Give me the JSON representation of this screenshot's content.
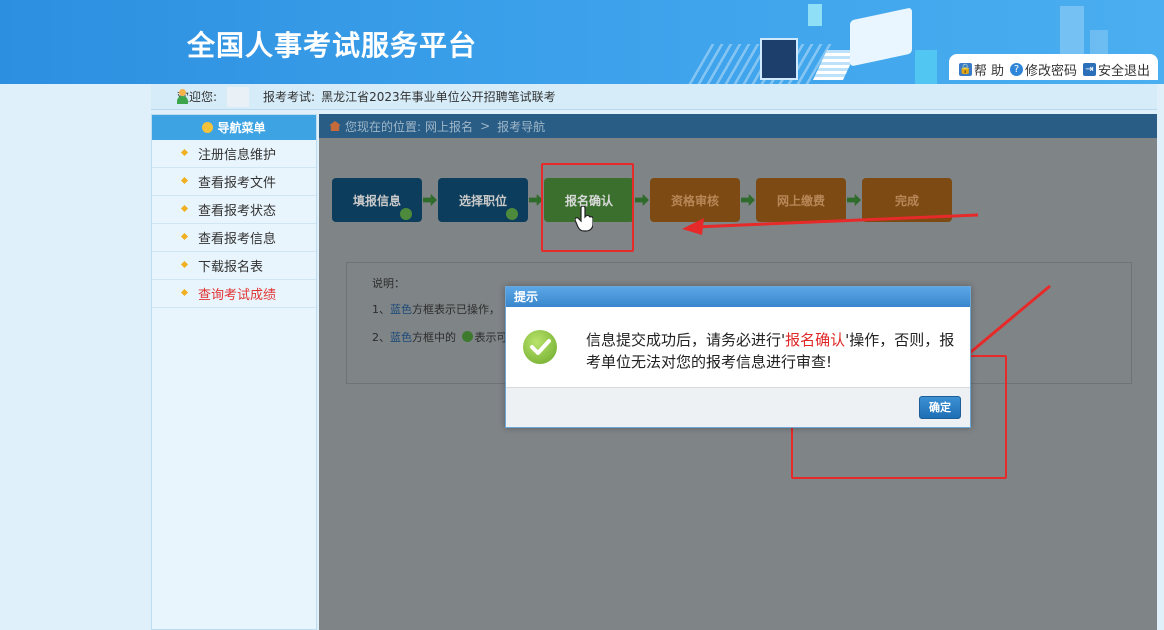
{
  "header": {
    "title": "全国人事考试服务平台",
    "links": [
      {
        "label": "帮 助",
        "icon": "lock-icon"
      },
      {
        "label": "修改密码",
        "icon": "question-icon"
      },
      {
        "label": "安全退出",
        "icon": "exit-icon"
      }
    ]
  },
  "infobar": {
    "welcome": "欢迎您:",
    "exam_label": "报考考试:",
    "exam_name": "黑龙江省2023年事业单位公开招聘笔试联考"
  },
  "sidebar": {
    "title": "导航菜单",
    "items": [
      {
        "label": "注册信息维护"
      },
      {
        "label": "查看报考文件"
      },
      {
        "label": "查看报考状态"
      },
      {
        "label": "查看报考信息"
      },
      {
        "label": "下载报名表"
      },
      {
        "label": "查询考试成绩"
      }
    ]
  },
  "breadcrumb": {
    "prefix": "您现在的位置:",
    "items": [
      "网上报名",
      "报考导航"
    ],
    "sep": ">"
  },
  "steps": [
    {
      "label": "填报信息",
      "state": "done"
    },
    {
      "label": "选择职位",
      "state": "done"
    },
    {
      "label": "报名确认",
      "state": "active"
    },
    {
      "label": "资格审核",
      "state": "todo"
    },
    {
      "label": "网上缴费",
      "state": "todo"
    },
    {
      "label": "完成",
      "state": "todo"
    }
  ],
  "explain": {
    "title": "说明：",
    "line1_prefix": "1、",
    "line1_blue": "蓝色",
    "line1_rest": "方框表示已操作，",
    "line2_prefix": "2、",
    "line2_blue": "蓝色",
    "line2_rest": "方框中的",
    "line2_tail": "表示可"
  },
  "dialog": {
    "title": "提示",
    "msg_part1": "信息提交成功后，请务必进行'",
    "msg_emph": "报名确认",
    "msg_part2": "'操作，否则，报考单位无法对您的报考信息进行审查!",
    "ok_label": "确定"
  },
  "colors": {
    "accent": "#3da3e3",
    "highlight": "#e62a2a"
  }
}
